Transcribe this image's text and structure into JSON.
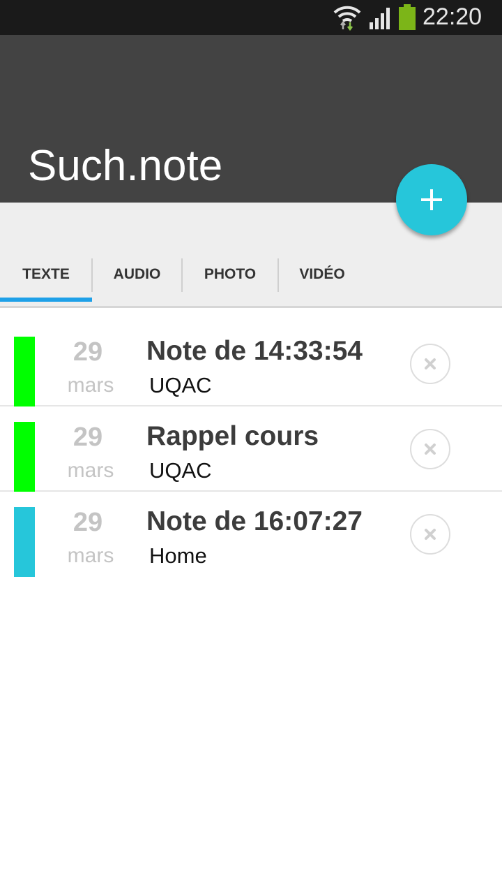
{
  "status_bar": {
    "time": "22:20",
    "icons": [
      "wifi-icon",
      "signal-icon",
      "battery-icon"
    ],
    "battery_color": "#7cb518"
  },
  "app_bar": {
    "title": "Such.note",
    "background": "#434343"
  },
  "fab": {
    "icon": "plus-icon",
    "color": "#26c6da"
  },
  "tabs": [
    {
      "label": "TEXTE",
      "selected": true
    },
    {
      "label": "AUDIO",
      "selected": false
    },
    {
      "label": "PHOTO",
      "selected": false
    },
    {
      "label": "VIDÉO",
      "selected": false
    }
  ],
  "tab_indicator_color": "#1ea0e8",
  "notes": [
    {
      "day": "29",
      "month": "mars",
      "title": "Note de 14:33:54",
      "subtitle": "UQAC",
      "color": "#00ff00",
      "delete_icon": "close-icon"
    },
    {
      "day": "29",
      "month": "mars",
      "title": "Rappel cours",
      "subtitle": "UQAC",
      "color": "#00ff00",
      "delete_icon": "close-icon"
    },
    {
      "day": "29",
      "month": "mars",
      "title": "Note de 16:07:27",
      "subtitle": "Home",
      "color": "#26c6da",
      "delete_icon": "close-icon"
    }
  ]
}
